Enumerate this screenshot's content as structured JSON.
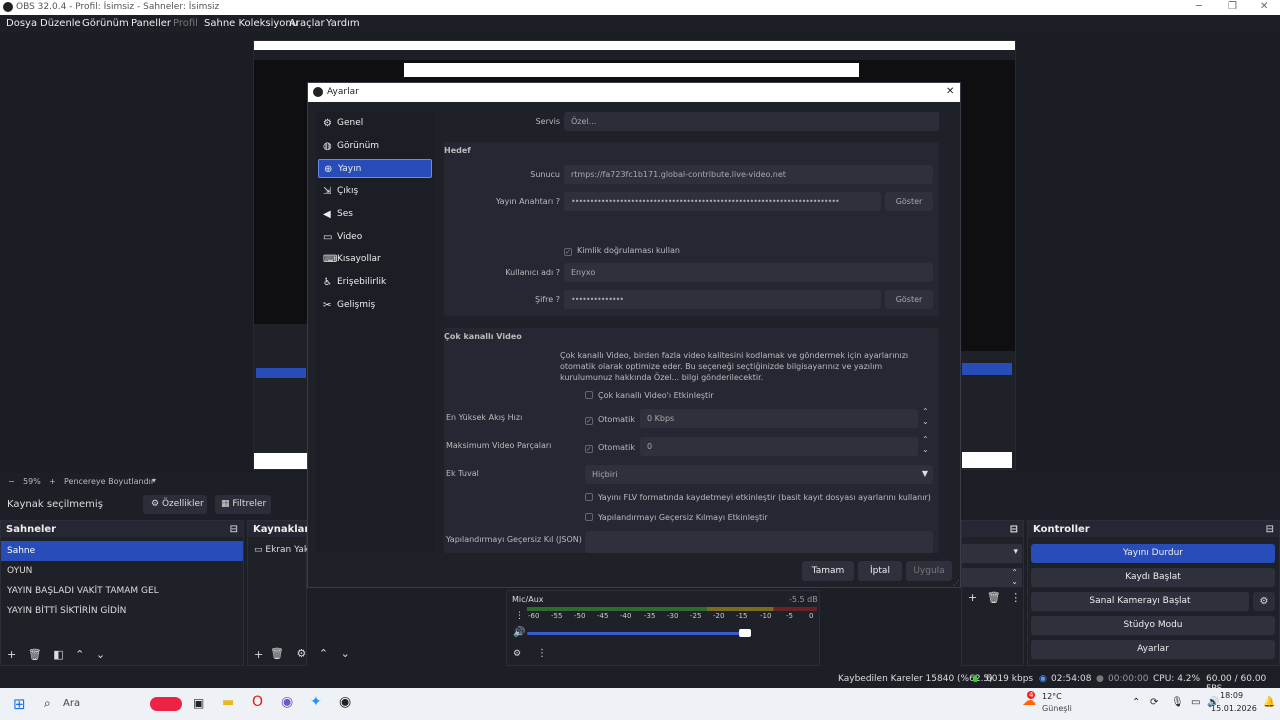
{
  "window": {
    "title": "OBS 32.0.4 - Profil: İsimsiz - Sahneler: İsimsiz"
  },
  "menu": [
    "Dosya",
    "Düzenle",
    "Görünüm",
    "Paneller",
    "Profil",
    "Sahne Koleksiyonu",
    "Araçlar",
    "Yardım"
  ],
  "preview": {
    "zoom": "59%",
    "resize_label": "Pencereye Boyutlandır"
  },
  "source_bar": {
    "no_source": "Kaynak seçilmemiş",
    "properties": "Özellikler",
    "filters": "Filtreler"
  },
  "scenes": {
    "title": "Sahneler",
    "items": [
      "Sahne",
      "OYUN",
      "YAYIN BAŞLADI VAKİT TAMAM GEL",
      "YAYIN BİTTİ SİKTİRİN GİDİN"
    ],
    "selected": 0
  },
  "sources": {
    "title": "Kaynaklar",
    "items": [
      "Ekran Yak"
    ]
  },
  "mixer": {
    "channel": "Mic/Aux",
    "db": "-5.5 dB",
    "ticks": [
      "-60",
      "-55",
      "-50",
      "-45",
      "-40",
      "-35",
      "-30",
      "-25",
      "-20",
      "-15",
      "-10",
      "-5",
      "0"
    ]
  },
  "controls": {
    "title": "Kontroller",
    "stop_stream": "Yayını Durdur",
    "start_record": "Kaydı Başlat",
    "start_vcam": "Sanal Kamerayı Başlat",
    "studio_mode": "Stüdyo Modu",
    "settings": "Ayarlar"
  },
  "status": {
    "dropped": "Kaybedilen Kareler 15840 (%62.5)",
    "bitrate": "6019 kbps",
    "stream_time": "02:54:08",
    "rec_time": "00:00:00",
    "cpu": "CPU: 4.2%",
    "fps": "60.00 / 60.00 FPS"
  },
  "taskbar": {
    "search": "Ara",
    "weather_temp": "12°C",
    "weather_desc": "Güneşli",
    "time": "18:09",
    "date": "15.01.2026",
    "badge": "4"
  },
  "dialog": {
    "title": "Ayarlar",
    "sidebar": [
      "Genel",
      "Görünüm",
      "Yayın",
      "Çıkış",
      "Ses",
      "Video",
      "Kısayollar",
      "Erişebilirlik",
      "Gelişmiş"
    ],
    "sidebar_selected": 2,
    "service_label": "Servis",
    "service_value": "Özel...",
    "dest_header": "Hedef",
    "server_label": "Sunucu",
    "server_value": "rtmps://fa723fc1b171.global-contribute.live-video.net",
    "key_label": "Yayın Anahtarı",
    "key_value": "••••••••••••••••••••••••••••••••••••••••••••••••••••••••••••••••••••••••",
    "show": "Göster",
    "use_auth": "Kimlik doğrulaması kullan",
    "username_label": "Kullanıcı adı",
    "username_value": "Enyxo",
    "password_label": "Şifre",
    "password_value": "••••••••••••••",
    "multitrack_header": "Çok kanallı Video",
    "multitrack_desc": "Çok kanallı Video, birden fazla video kalitesini kodlamak ve göndermek için ayarlarınızı otomatik olarak optimize eder. Bu seçeneği seçtiğinizde bilgisayarınız ve yazılım kurulumunuz hakkında Özel... bilgi gönderilecektir.",
    "enable_multitrack": "Çok kanallı Video'ı Etkinleştir",
    "max_bitrate_label": "En Yüksek Akış Hızı",
    "auto": "Otomatik",
    "max_bitrate_value": "0 Kbps",
    "max_tracks_label": "Maksimum Video Parçaları",
    "max_tracks_value": "0",
    "extra_canvas_label": "Ek Tuval",
    "extra_canvas_value": "Hiçbiri",
    "flv_option": "Yayını FLV formatında kaydetmeyi etkinleştir (basit kayıt dosyası ayarlarını kullanır)",
    "config_override": "Yapılandırmayı Geçersiz Kılmayı Etkinleştir",
    "config_json_label": "Yapılandırmayı Geçersiz Kıl (JSON)",
    "ok": "Tamam",
    "cancel": "İptal",
    "apply": "Uygula"
  }
}
